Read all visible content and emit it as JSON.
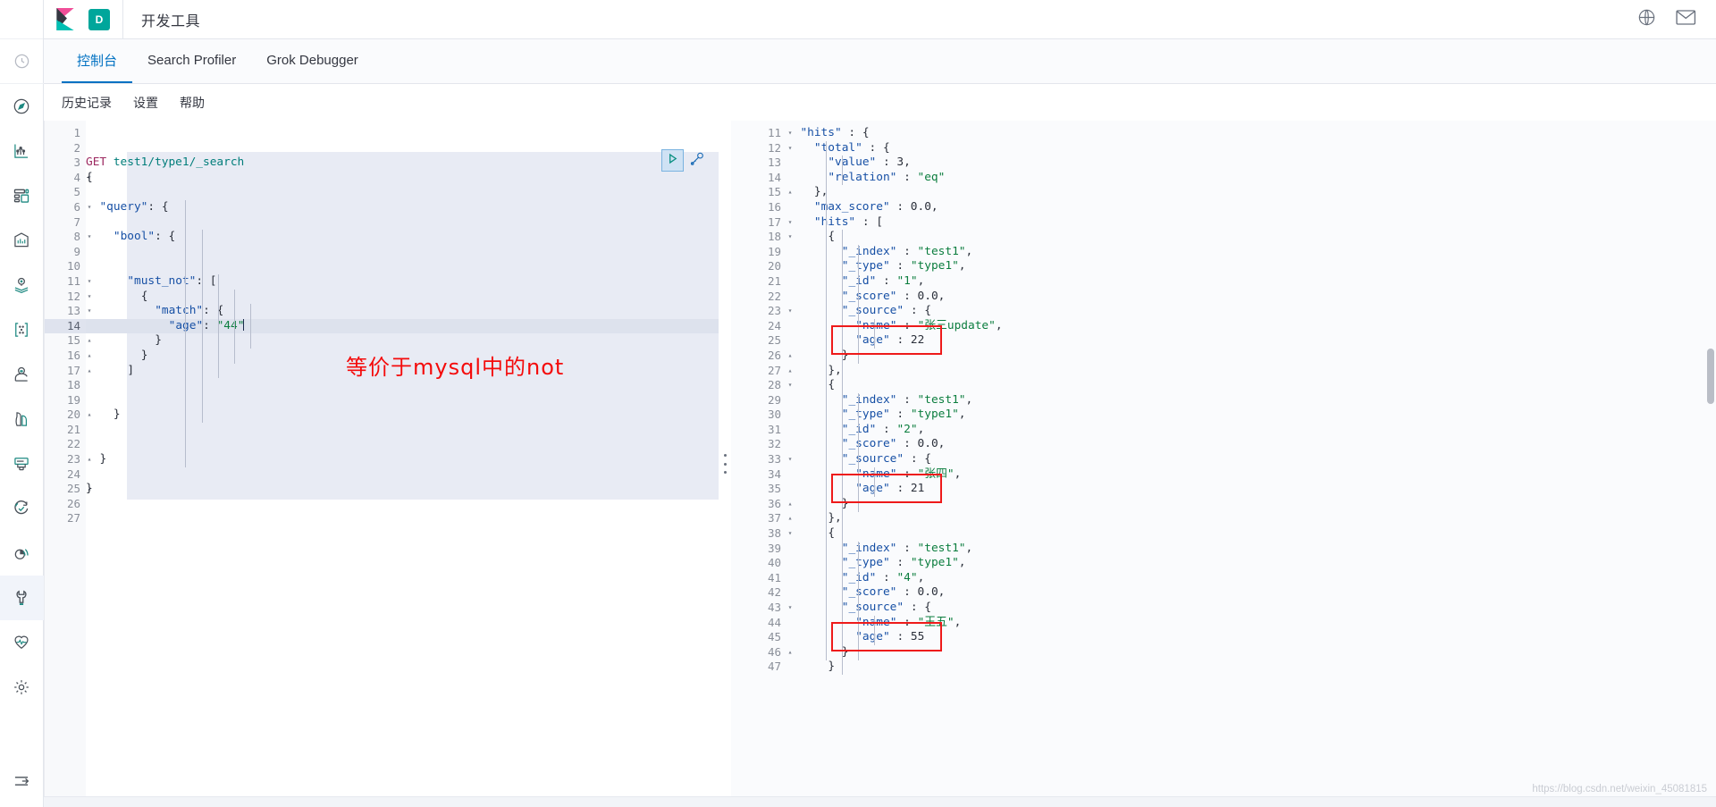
{
  "header": {
    "logo_icon": "kibana-logo",
    "space_badge": "D",
    "app_title": "开发工具",
    "globe_icon": "globe-help-icon",
    "mail_icon": "mail-icon"
  },
  "sidebar": {
    "items": [
      {
        "name": "recently-viewed",
        "icon": "clock-icon",
        "label": "最近查看",
        "active": false,
        "separator": true
      },
      {
        "name": "discover",
        "icon": "compass-icon",
        "label": "Discover",
        "active": false
      },
      {
        "name": "visualize",
        "icon": "bar-chart-icon",
        "label": "Visualize",
        "active": false
      },
      {
        "name": "dashboard",
        "icon": "dashboard-icon",
        "label": "Dashboard",
        "active": false
      },
      {
        "name": "canvas",
        "icon": "canvas-icon",
        "label": "Canvas",
        "active": false
      },
      {
        "name": "maps",
        "icon": "maps-pin-icon",
        "label": "Maps",
        "active": false
      },
      {
        "name": "graph",
        "icon": "graph-nodes-icon",
        "label": "Graph",
        "active": false
      },
      {
        "name": "ml",
        "icon": "machine-learning-icon",
        "label": "Machine Learning",
        "active": false
      },
      {
        "name": "infrastructure",
        "icon": "infrastructure-icon",
        "label": "Infrastructure",
        "active": false
      },
      {
        "name": "logs",
        "icon": "logs-icon",
        "label": "Logs",
        "active": false
      },
      {
        "name": "uptime",
        "icon": "uptime-check-icon",
        "label": "Uptime",
        "active": false
      },
      {
        "name": "apm",
        "icon": "apm-signal-icon",
        "label": "APM",
        "active": false
      },
      {
        "name": "dev-tools",
        "icon": "wrench-icon",
        "label": "开发工具",
        "active": true
      },
      {
        "name": "monitoring",
        "icon": "heartbeat-icon",
        "label": "Monitoring",
        "active": false
      },
      {
        "name": "management",
        "icon": "gear-icon",
        "label": "Management",
        "active": false
      }
    ],
    "collapse_icon": "collapse-arrow-icon"
  },
  "tabs": [
    {
      "label": "控制台",
      "active": true
    },
    {
      "label": "Search Profiler",
      "active": false
    },
    {
      "label": "Grok Debugger",
      "active": false
    }
  ],
  "submenu": [
    {
      "label": "历史记录"
    },
    {
      "label": "设置"
    },
    {
      "label": "帮助"
    }
  ],
  "console": {
    "run_icon": "play-triangle-icon",
    "wrench_icon": "wrench-tools-icon",
    "annotation": "等价于mysql中的not",
    "annotation_color": "#f40b0b",
    "request": {
      "method": "GET",
      "path": "test1/type1/_search",
      "cursor_line": 14,
      "total_lines": 27,
      "lines": [
        {
          "n": 1,
          "fold": "",
          "text": ""
        },
        {
          "n": 2,
          "fold": "",
          "text": ""
        },
        {
          "n": 3,
          "fold": "",
          "text": "GET test1/type1/_search"
        },
        {
          "n": 4,
          "fold": "▾",
          "text": "{"
        },
        {
          "n": 5,
          "fold": "",
          "text": ""
        },
        {
          "n": 6,
          "fold": "▾",
          "text": "  \"query\": {"
        },
        {
          "n": 7,
          "fold": "",
          "text": ""
        },
        {
          "n": 8,
          "fold": "▾",
          "text": "    \"bool\": {"
        },
        {
          "n": 9,
          "fold": "",
          "text": ""
        },
        {
          "n": 10,
          "fold": "",
          "text": ""
        },
        {
          "n": 11,
          "fold": "▾",
          "text": "      \"must_not\": ["
        },
        {
          "n": 12,
          "fold": "▾",
          "text": "        {"
        },
        {
          "n": 13,
          "fold": "▾",
          "text": "          \"match\": {"
        },
        {
          "n": 14,
          "fold": "",
          "text": "            \"age\": \"44\""
        },
        {
          "n": 15,
          "fold": "▴",
          "text": "          }"
        },
        {
          "n": 16,
          "fold": "▴",
          "text": "        }"
        },
        {
          "n": 17,
          "fold": "▴",
          "text": "      ]"
        },
        {
          "n": 18,
          "fold": "",
          "text": ""
        },
        {
          "n": 19,
          "fold": "",
          "text": ""
        },
        {
          "n": 20,
          "fold": "▴",
          "text": "    }"
        },
        {
          "n": 21,
          "fold": "",
          "text": ""
        },
        {
          "n": 22,
          "fold": "",
          "text": ""
        },
        {
          "n": 23,
          "fold": "▴",
          "text": "  }"
        },
        {
          "n": 24,
          "fold": "",
          "text": ""
        },
        {
          "n": 25,
          "fold": "▴",
          "text": "}"
        },
        {
          "n": 26,
          "fold": "",
          "text": ""
        },
        {
          "n": 27,
          "fold": "",
          "text": ""
        }
      ]
    },
    "response": {
      "first_visible_line": 11,
      "last_visible_line": 47,
      "lines": [
        {
          "n": 11,
          "fold": "▾",
          "text": "  \"hits\" : {"
        },
        {
          "n": 12,
          "fold": "▾",
          "text": "    \"total\" : {"
        },
        {
          "n": 13,
          "fold": "",
          "text": "      \"value\" : 3,"
        },
        {
          "n": 14,
          "fold": "",
          "text": "      \"relation\" : \"eq\""
        },
        {
          "n": 15,
          "fold": "▴",
          "text": "    },"
        },
        {
          "n": 16,
          "fold": "",
          "text": "    \"max_score\" : 0.0,"
        },
        {
          "n": 17,
          "fold": "▾",
          "text": "    \"hits\" : ["
        },
        {
          "n": 18,
          "fold": "▾",
          "text": "      {"
        },
        {
          "n": 19,
          "fold": "",
          "text": "        \"_index\" : \"test1\","
        },
        {
          "n": 20,
          "fold": "",
          "text": "        \"_type\" : \"type1\","
        },
        {
          "n": 21,
          "fold": "",
          "text": "        \"_id\" : \"1\","
        },
        {
          "n": 22,
          "fold": "",
          "text": "        \"_score\" : 0.0,"
        },
        {
          "n": 23,
          "fold": "▾",
          "text": "        \"_source\" : {"
        },
        {
          "n": 24,
          "fold": "",
          "text": "          \"name\" : \"张三update\","
        },
        {
          "n": 25,
          "fold": "",
          "text": "          \"age\" : 22"
        },
        {
          "n": 26,
          "fold": "▴",
          "text": "        }"
        },
        {
          "n": 27,
          "fold": "▴",
          "text": "      },"
        },
        {
          "n": 28,
          "fold": "▾",
          "text": "      {"
        },
        {
          "n": 29,
          "fold": "",
          "text": "        \"_index\" : \"test1\","
        },
        {
          "n": 30,
          "fold": "",
          "text": "        \"_type\" : \"type1\","
        },
        {
          "n": 31,
          "fold": "",
          "text": "        \"_id\" : \"2\","
        },
        {
          "n": 32,
          "fold": "",
          "text": "        \"_score\" : 0.0,"
        },
        {
          "n": 33,
          "fold": "▾",
          "text": "        \"_source\" : {"
        },
        {
          "n": 34,
          "fold": "",
          "text": "          \"name\" : \"张四\","
        },
        {
          "n": 35,
          "fold": "",
          "text": "          \"age\" : 21"
        },
        {
          "n": 36,
          "fold": "▴",
          "text": "        }"
        },
        {
          "n": 37,
          "fold": "▴",
          "text": "      },"
        },
        {
          "n": 38,
          "fold": "▾",
          "text": "      {"
        },
        {
          "n": 39,
          "fold": "",
          "text": "        \"_index\" : \"test1\","
        },
        {
          "n": 40,
          "fold": "",
          "text": "        \"_type\" : \"type1\","
        },
        {
          "n": 41,
          "fold": "",
          "text": "        \"_id\" : \"4\","
        },
        {
          "n": 42,
          "fold": "",
          "text": "        \"_score\" : 0.0,"
        },
        {
          "n": 43,
          "fold": "▾",
          "text": "        \"_source\" : {"
        },
        {
          "n": 44,
          "fold": "",
          "text": "          \"name\" : \"王五\","
        },
        {
          "n": 45,
          "fold": "",
          "text": "          \"age\" : 55"
        },
        {
          "n": 46,
          "fold": "▴",
          "text": "        }"
        },
        {
          "n": 47,
          "fold": "",
          "text": "      }"
        }
      ],
      "highlight_boxes": [
        {
          "label": "age-22-highlight",
          "line": 25
        },
        {
          "label": "age-21-highlight",
          "line": 35
        },
        {
          "label": "age-55-highlight",
          "line": 45
        }
      ]
    }
  },
  "watermark": "https://blog.csdn.net/weixin_45081815"
}
